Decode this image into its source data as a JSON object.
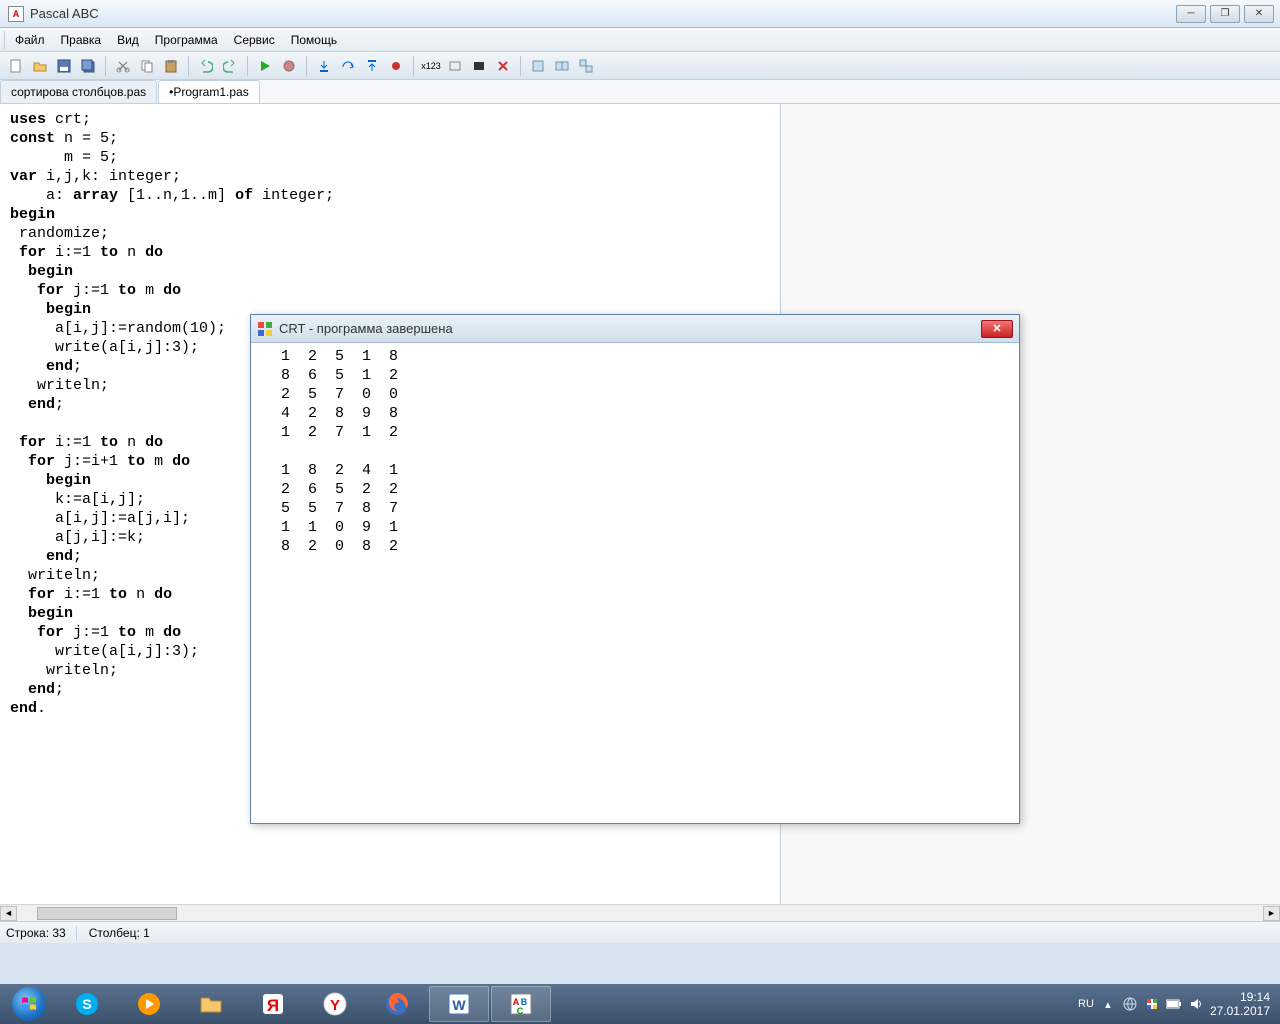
{
  "window": {
    "title": "Pascal ABC"
  },
  "menu": {
    "items": [
      "Файл",
      "Правка",
      "Вид",
      "Программа",
      "Сервис",
      "Помощь"
    ]
  },
  "tabs": [
    {
      "label": "сортирова столбцов.pas",
      "active": false
    },
    {
      "label": "•Program1.pas",
      "active": true
    }
  ],
  "code_tokens": [
    [
      [
        "uses",
        "kw"
      ],
      [
        " crt;",
        ""
      ]
    ],
    [
      [
        "const",
        "kw"
      ],
      [
        " n = 5;",
        ""
      ]
    ],
    [
      [
        "      m = 5;",
        ""
      ]
    ],
    [
      [
        "var",
        "kw"
      ],
      [
        " i,j,k: integer;",
        ""
      ]
    ],
    [
      [
        "    a: ",
        ""
      ],
      [
        "array",
        "kw"
      ],
      [
        " [1..n,1..m] ",
        ""
      ],
      [
        "of",
        "kw"
      ],
      [
        " integer;",
        ""
      ]
    ],
    [
      [
        "begin",
        "kw"
      ]
    ],
    [
      [
        " randomize;",
        ""
      ]
    ],
    [
      [
        " ",
        ""
      ],
      [
        "for",
        "kw"
      ],
      [
        " i:=1 ",
        ""
      ],
      [
        "to",
        "kw"
      ],
      [
        " n ",
        ""
      ],
      [
        "do",
        "kw"
      ]
    ],
    [
      [
        "  ",
        ""
      ],
      [
        "begin",
        "kw"
      ]
    ],
    [
      [
        "   ",
        ""
      ],
      [
        "for",
        "kw"
      ],
      [
        " j:=1 ",
        ""
      ],
      [
        "to",
        "kw"
      ],
      [
        " m ",
        ""
      ],
      [
        "do",
        "kw"
      ]
    ],
    [
      [
        "    ",
        ""
      ],
      [
        "begin",
        "kw"
      ]
    ],
    [
      [
        "     a[i,j]:=random(10);",
        ""
      ]
    ],
    [
      [
        "     write(a[i,j]:3);",
        ""
      ]
    ],
    [
      [
        "    ",
        ""
      ],
      [
        "end",
        "kw"
      ],
      [
        ";",
        ""
      ]
    ],
    [
      [
        "   writeln;",
        ""
      ]
    ],
    [
      [
        "  ",
        ""
      ],
      [
        "end",
        "kw"
      ],
      [
        ";",
        ""
      ]
    ],
    [
      [
        "",
        ""
      ]
    ],
    [
      [
        " ",
        ""
      ],
      [
        "for",
        "kw"
      ],
      [
        " i:=1 ",
        ""
      ],
      [
        "to",
        "kw"
      ],
      [
        " n ",
        ""
      ],
      [
        "do",
        "kw"
      ]
    ],
    [
      [
        "  ",
        ""
      ],
      [
        "for",
        "kw"
      ],
      [
        " j:=i+1 ",
        ""
      ],
      [
        "to",
        "kw"
      ],
      [
        " m ",
        ""
      ],
      [
        "do",
        "kw"
      ]
    ],
    [
      [
        "    ",
        ""
      ],
      [
        "begin",
        "kw"
      ]
    ],
    [
      [
        "     k:=a[i,j];",
        ""
      ]
    ],
    [
      [
        "     a[i,j]:=a[j,i];",
        ""
      ]
    ],
    [
      [
        "     a[j,i]:=k;",
        ""
      ]
    ],
    [
      [
        "    ",
        ""
      ],
      [
        "end",
        "kw"
      ],
      [
        ";",
        ""
      ]
    ],
    [
      [
        "  writeln;",
        ""
      ]
    ],
    [
      [
        "  ",
        ""
      ],
      [
        "for",
        "kw"
      ],
      [
        " i:=1 ",
        ""
      ],
      [
        "to",
        "kw"
      ],
      [
        " n ",
        ""
      ],
      [
        "do",
        "kw"
      ]
    ],
    [
      [
        "  ",
        ""
      ],
      [
        "begin",
        "kw"
      ]
    ],
    [
      [
        "   ",
        ""
      ],
      [
        "for",
        "kw"
      ],
      [
        " j:=1 ",
        ""
      ],
      [
        "to",
        "kw"
      ],
      [
        " m ",
        ""
      ],
      [
        "do",
        "kw"
      ]
    ],
    [
      [
        "     write(a[i,j]:3);",
        ""
      ]
    ],
    [
      [
        "    writeln;",
        ""
      ]
    ],
    [
      [
        "  ",
        ""
      ],
      [
        "end",
        "kw"
      ],
      [
        ";",
        ""
      ]
    ],
    [
      [
        "end",
        "kw"
      ],
      [
        ".",
        ""
      ]
    ]
  ],
  "crt": {
    "title": "CRT - программа завершена",
    "output_lines": [
      "  1  2  5  1  8",
      "  8  6  5  1  2",
      "  2  5  7  0  0",
      "  4  2  8  9  8",
      "  1  2  7  1  2",
      "",
      "  1  8  2  4  1",
      "  2  6  5  2  2",
      "  5  5  7  8  7",
      "  1  1  0  9  1",
      "  8  2  0  8  2"
    ]
  },
  "status": {
    "line_label": "Строка: 33",
    "col_label": "Столбец: 1"
  },
  "tray": {
    "lang": "RU",
    "time": "19:14",
    "date": "27.01.2017"
  }
}
